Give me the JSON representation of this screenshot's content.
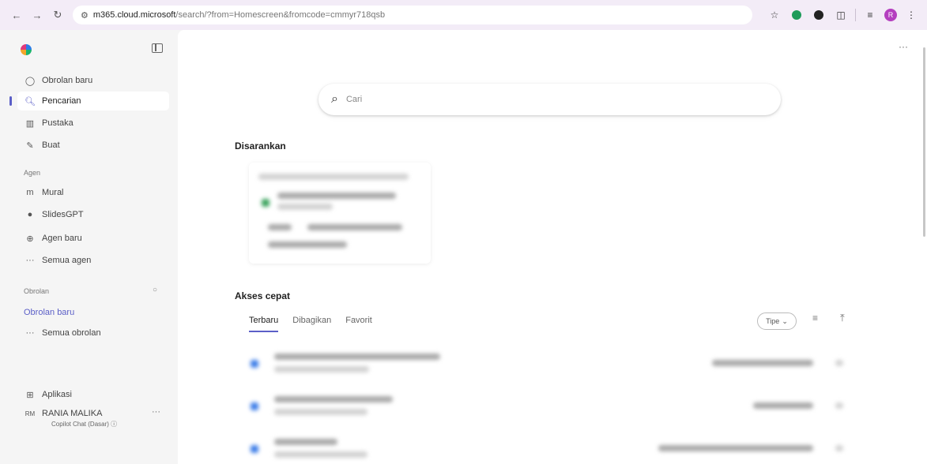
{
  "browser": {
    "url_host": "m365.cloud.microsoft",
    "url_path": "/search/?from=Homescreen&fromcode=cmmyr718qsb",
    "profile_initial": "R"
  },
  "sidebar": {
    "nav": [
      {
        "label": "Obrolan baru",
        "icon": "chat-bubble-icon"
      },
      {
        "label": "Pencarian",
        "icon": "search-icon"
      },
      {
        "label": "Pustaka",
        "icon": "library-icon"
      },
      {
        "label": "Buat",
        "icon": "create-icon"
      }
    ],
    "agents_heading": "Agen",
    "agents": [
      {
        "label": "Mural",
        "icon": "mural-icon"
      },
      {
        "label": "SlidesGPT",
        "icon": "slidesgpt-icon"
      },
      {
        "label": "Agen baru",
        "icon": "new-agent-icon"
      },
      {
        "label": "Semua agen",
        "icon": "more-icon"
      }
    ],
    "chats_heading": "Obrolan",
    "recent_chat": "Obrolan baru",
    "all_chats": "Semua obrolan",
    "apps": "Aplikasi",
    "user_initials": "RM",
    "user_name": "RANIA MALIKA",
    "footer": "Copilot Chat (Dasar)"
  },
  "main": {
    "search_placeholder": "Cari",
    "suggested_heading": "Disarankan",
    "quick_access_heading": "Akses cepat",
    "tabs": [
      "Terbaru",
      "Dibagikan",
      "Favorit"
    ],
    "type_filter": "Tipe"
  },
  "colors": {
    "accent": "#5b5fc7",
    "browser_bar": "#f3ecf7",
    "sidebar_bg": "#f5f5f5"
  }
}
